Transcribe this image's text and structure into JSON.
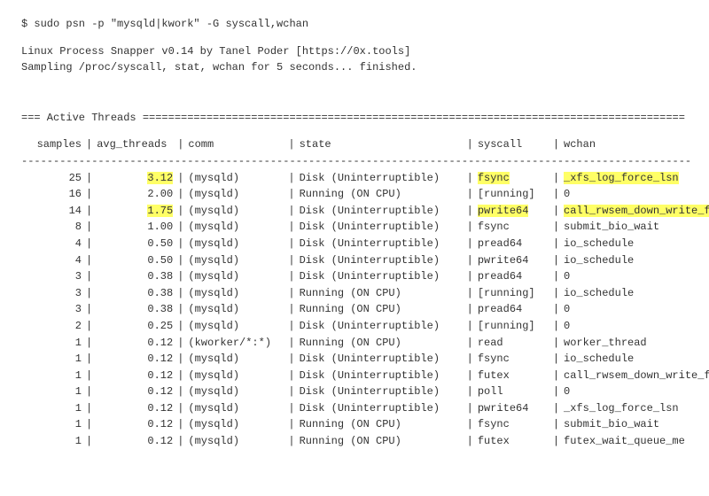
{
  "prompt": "$ sudo psn -p \"mysqld|kwork\" -G syscall,wchan",
  "banner1": "Linux Process Snapper v0.14 by Tanel Poder [https://0x.tools]",
  "banner2": "Sampling /proc/syscall, stat, wchan for 5 seconds... finished.",
  "section_title": "=== Active Threads =====================================================================================",
  "dash_line": "---------------------------------------------------------------------------------------------------------",
  "headers": {
    "samples": "samples",
    "avg": "avg_threads",
    "comm": "comm",
    "state": "state",
    "syscall": "syscall",
    "wchan": "wchan"
  },
  "rows": [
    {
      "samples": "25",
      "avg": "3.12",
      "comm": "(mysqld)",
      "state": "Disk (Uninterruptible)",
      "syscall": "fsync",
      "wchan": "_xfs_log_force_lsn",
      "hl_avg": true,
      "hl_syscall": true,
      "hl_wchan": true
    },
    {
      "samples": "16",
      "avg": "2.00",
      "comm": "(mysqld)",
      "state": "Running (ON CPU)",
      "syscall": "[running]",
      "wchan": "0"
    },
    {
      "samples": "14",
      "avg": "1.75",
      "comm": "(mysqld)",
      "state": "Disk (Uninterruptible)",
      "syscall": "pwrite64",
      "wchan": "call_rwsem_down_write_failed",
      "hl_avg": true,
      "hl_syscall": true,
      "hl_wchan": true
    },
    {
      "samples": "8",
      "avg": "1.00",
      "comm": "(mysqld)",
      "state": "Disk (Uninterruptible)",
      "syscall": "fsync",
      "wchan": "submit_bio_wait"
    },
    {
      "samples": "4",
      "avg": "0.50",
      "comm": "(mysqld)",
      "state": "Disk (Uninterruptible)",
      "syscall": "pread64",
      "wchan": "io_schedule"
    },
    {
      "samples": "4",
      "avg": "0.50",
      "comm": "(mysqld)",
      "state": "Disk (Uninterruptible)",
      "syscall": "pwrite64",
      "wchan": "io_schedule"
    },
    {
      "samples": "3",
      "avg": "0.38",
      "comm": "(mysqld)",
      "state": "Disk (Uninterruptible)",
      "syscall": "pread64",
      "wchan": "0"
    },
    {
      "samples": "3",
      "avg": "0.38",
      "comm": "(mysqld)",
      "state": "Running (ON CPU)",
      "syscall": "[running]",
      "wchan": "io_schedule"
    },
    {
      "samples": "3",
      "avg": "0.38",
      "comm": "(mysqld)",
      "state": "Running (ON CPU)",
      "syscall": "pread64",
      "wchan": "0"
    },
    {
      "samples": "2",
      "avg": "0.25",
      "comm": "(mysqld)",
      "state": "Disk (Uninterruptible)",
      "syscall": "[running]",
      "wchan": "0"
    },
    {
      "samples": "1",
      "avg": "0.12",
      "comm": "(kworker/*:*)",
      "state": "Running (ON CPU)",
      "syscall": "read",
      "wchan": "worker_thread"
    },
    {
      "samples": "1",
      "avg": "0.12",
      "comm": "(mysqld)",
      "state": "Disk (Uninterruptible)",
      "syscall": "fsync",
      "wchan": "io_schedule"
    },
    {
      "samples": "1",
      "avg": "0.12",
      "comm": "(mysqld)",
      "state": "Disk (Uninterruptible)",
      "syscall": "futex",
      "wchan": "call_rwsem_down_write_failed"
    },
    {
      "samples": "1",
      "avg": "0.12",
      "comm": "(mysqld)",
      "state": "Disk (Uninterruptible)",
      "syscall": "poll",
      "wchan": "0"
    },
    {
      "samples": "1",
      "avg": "0.12",
      "comm": "(mysqld)",
      "state": "Disk (Uninterruptible)",
      "syscall": "pwrite64",
      "wchan": "_xfs_log_force_lsn"
    },
    {
      "samples": "1",
      "avg": "0.12",
      "comm": "(mysqld)",
      "state": "Running (ON CPU)",
      "syscall": "fsync",
      "wchan": "submit_bio_wait"
    },
    {
      "samples": "1",
      "avg": "0.12",
      "comm": "(mysqld)",
      "state": "Running (ON CPU)",
      "syscall": "futex",
      "wchan": "futex_wait_queue_me"
    }
  ]
}
